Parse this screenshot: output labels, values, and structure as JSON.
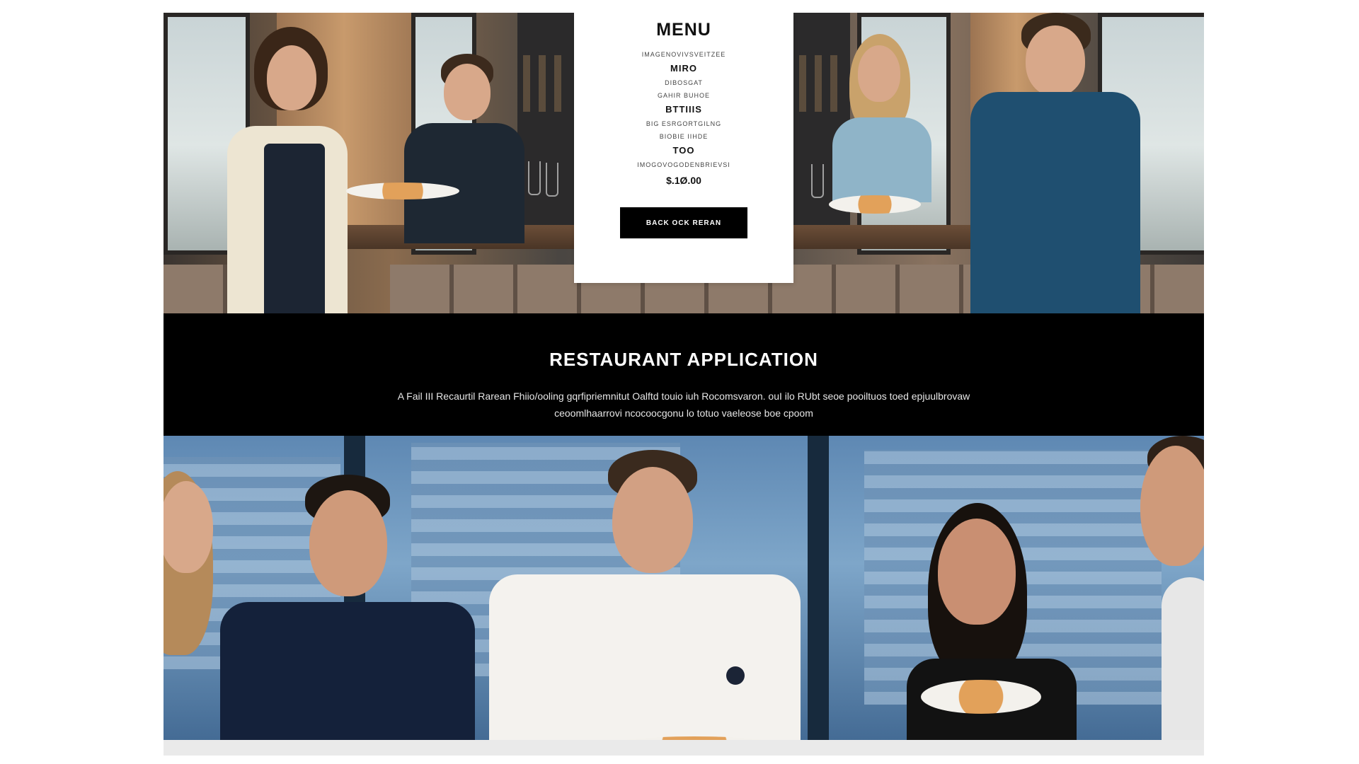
{
  "menu": {
    "title": "MENU",
    "line_1": "IMAGENOVIVSVEITZEE",
    "item_1": "MIRO",
    "line_2": "DIBOSGAT",
    "line_3": "GAHIR BUHOE",
    "item_2": "BTTIIIS",
    "line_4": "BIG ESRGORTGILNG",
    "line_5": "BIOBIE IIHDE",
    "item_3": "TOO",
    "line_6": "IMOGOVOGODENBRIEVSI",
    "price": "$.1Ø.00",
    "button_label": "BACK OCK RERAN"
  },
  "banner": {
    "title": "RESTAURANT APPLICATION",
    "description": "A Fail III Recaurtil Rarean Fhiio/ooling gqrfipriemnitut Oalftd touio iuh Rocomsvaron. ouI ilo RUbt seoe pooiltuos toed epjuulbrovaw ceoomlhaarrovi ncocoocgonu lo totuo vaeleose boe cpoom"
  },
  "colors": {
    "banner_bg": "#000000",
    "card_bg": "#ffffff",
    "button_bg": "#000000"
  }
}
